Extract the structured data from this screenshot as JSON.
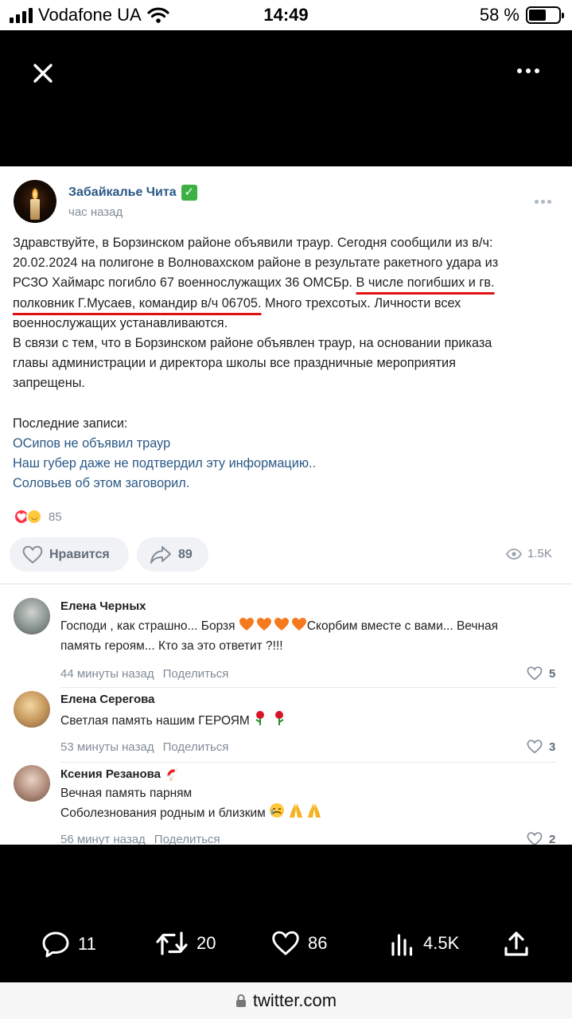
{
  "status_bar": {
    "carrier": "Vodafone UA",
    "time": "14:49",
    "battery": "58 %",
    "battery_level": 0.58
  },
  "post": {
    "author": "Забайкалье Чита",
    "time": "час назад",
    "text_lines": [
      "Здравствуйте, в Борзинском районе объявили траур. Сегодня сообщили из в/ч:",
      "20.02.2024 на полигоне в Волновахском районе в результате ракетного удара из",
      "РСЗО Хаймарс погибло 67 военнослужащих 36 ОМСБр. ",
      "В числе погибших и гв.",
      "полковник Г.Мусаев, командир в/ч 06705.",
      " Много трехсотых. Личности всех",
      "военнослужащих устанавливаются.",
      "В связи с тем, что в Борзинском районе объявлен траур, на основании приказа",
      "главы администрации и директора школы все праздничные мероприятия",
      "запрещены."
    ],
    "recent_label": "Последние записи:",
    "recent_links": [
      "ОСипов не объявил траур",
      "Наш губер даже не подтвердил эту информацию..",
      "Соловьев об этом заговорил."
    ],
    "reactions_count": "85",
    "like_label": "Нравится",
    "shares_count": "89",
    "views": "1.5K"
  },
  "comments": [
    {
      "name": "Елена Черных",
      "lines": [
        "Господи , как страшно... Борзя",
        "Скорбим вместе с вами... Вечная",
        "память героям... Кто за это ответит ?!!!"
      ],
      "time": "44 минуты назад",
      "share": "Поделиться",
      "likes": "5"
    },
    {
      "name": "Елена Серегова",
      "lines": [
        "Светлая память нашим ГЕРОЯМ"
      ],
      "time": "53 минуты назад",
      "share": "Поделиться",
      "likes": "3"
    },
    {
      "name": "Ксения Резанова",
      "lines": [
        "Вечная память парням",
        "Соболезнования родным и близким"
      ],
      "time": "56 минут назад",
      "share": "Поделиться",
      "likes": "2"
    }
  ],
  "tweet_actions": {
    "replies": "11",
    "retweets": "20",
    "likes": "86",
    "views": "4.5K"
  },
  "url": "twitter.com"
}
